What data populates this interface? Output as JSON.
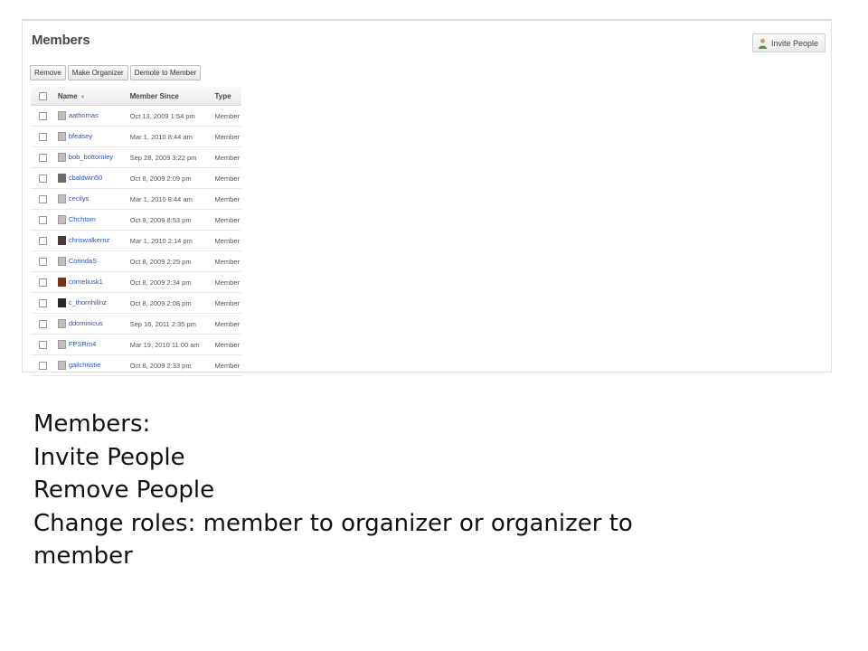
{
  "panel": {
    "title": "Members",
    "invite_button": "Invite People",
    "toolbar": [
      "Remove",
      "Make Organizer",
      "Demote to Member"
    ],
    "columns": [
      "Name",
      "Member Since",
      "Type"
    ],
    "rows": [
      {
        "name": "aathomas",
        "since": "Oct 13, 2009 1:54 pm",
        "type": "Member",
        "avatar": "default"
      },
      {
        "name": "bfeasey",
        "since": "Mar 1, 2010 8:44 am",
        "type": "Member",
        "avatar": "default"
      },
      {
        "name": "bob_bottomley",
        "since": "Sep 28, 2009 3:22 pm",
        "type": "Member",
        "avatar": "default"
      },
      {
        "name": "cbaldwin50",
        "since": "Oct 8, 2009 2:09 pm",
        "type": "Member",
        "avatar": "photo"
      },
      {
        "name": "cecilys",
        "since": "Mar 1, 2010 8:44 am",
        "type": "Member",
        "avatar": "default"
      },
      {
        "name": "Chchtom",
        "since": "Oct 9, 2009 8:53 pm",
        "type": "Member",
        "avatar": "default"
      },
      {
        "name": "chriswalkernz",
        "since": "Mar 1, 2010 2:14 pm",
        "type": "Member",
        "avatar": "photo"
      },
      {
        "name": "CorindaS",
        "since": "Oct 8, 2009 2:25 pm",
        "type": "Member",
        "avatar": "default"
      },
      {
        "name": "corneliusk1",
        "since": "Oct 8, 2009 2:34 pm",
        "type": "Member",
        "avatar": "photo"
      },
      {
        "name": "c_thornhillnz",
        "since": "Oct 8, 2009 2:08 pm",
        "type": "Member",
        "avatar": "photo"
      },
      {
        "name": "ddominicus",
        "since": "Sep 16, 2011 2:35 pm",
        "type": "Member",
        "avatar": "default"
      },
      {
        "name": "FPSRm4",
        "since": "Mar 19, 2010 11:00 am",
        "type": "Member",
        "avatar": "default"
      },
      {
        "name": "gailchristie",
        "since": "Oct 8, 2009 2:33 pm",
        "type": "Member",
        "avatar": "default"
      }
    ]
  },
  "caption": {
    "line1": "Members:",
    "line2": "Invite People",
    "line3": "Remove People",
    "line4": "Change roles: member to organizer or organizer to",
    "line5": "member"
  },
  "colors": {
    "link": "#2a55b0",
    "panel_border": "#e2e2e2",
    "accent_top": "#cfe3d6"
  }
}
